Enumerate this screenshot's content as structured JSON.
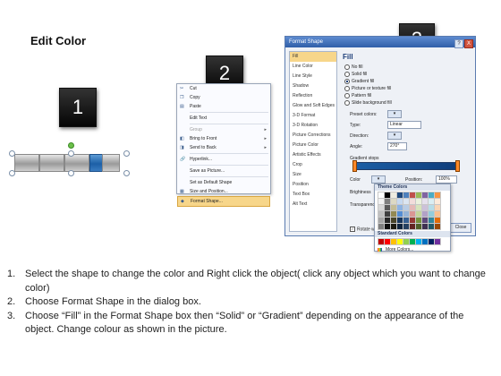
{
  "title": "Edit Color",
  "badges": [
    "1",
    "2",
    "3"
  ],
  "context_menu": {
    "items": [
      {
        "label": "Cut",
        "icon": "scissors-icon",
        "glyph": "✂",
        "enabled": true
      },
      {
        "label": "Copy",
        "icon": "copy-icon",
        "glyph": "❐",
        "enabled": true
      },
      {
        "label": "Paste",
        "icon": "paste-icon",
        "glyph": "▤",
        "enabled": true
      },
      {
        "label": "Edit Text",
        "icon": "edit-text-icon",
        "glyph": "",
        "enabled": true
      },
      {
        "label": "Group",
        "icon": "group-icon",
        "glyph": "",
        "enabled": false,
        "submenu": true
      },
      {
        "label": "Bring to Front",
        "icon": "bring-front-icon",
        "glyph": "◧",
        "enabled": true,
        "submenu": true
      },
      {
        "label": "Send to Back",
        "icon": "send-back-icon",
        "glyph": "◨",
        "enabled": true,
        "submenu": true
      },
      {
        "label": "Hyperlink...",
        "icon": "hyperlink-icon",
        "glyph": "🔗",
        "enabled": true
      },
      {
        "label": "Save as Picture...",
        "icon": "",
        "glyph": "",
        "enabled": true
      },
      {
        "label": "Set as Default Shape",
        "icon": "",
        "glyph": "",
        "enabled": true
      },
      {
        "label": "Size and Position...",
        "icon": "size-position-icon",
        "glyph": "▦",
        "enabled": true
      },
      {
        "label": "Format Shape...",
        "icon": "format-shape-icon",
        "glyph": "◆",
        "enabled": true,
        "highlighted": true
      }
    ]
  },
  "dialog": {
    "title": "Format Shape",
    "title_buttons": [
      "?",
      "X"
    ],
    "nav": [
      "Fill",
      "Line Color",
      "Line Style",
      "Shadow",
      "Reflection",
      "Glow and Soft Edges",
      "3-D Format",
      "3-D Rotation",
      "Picture Corrections",
      "Picture Color",
      "Artistic Effects",
      "Crop",
      "Size",
      "Position",
      "Text Box",
      "Alt Text"
    ],
    "nav_selected": 0,
    "panel": {
      "heading": "Fill",
      "fill_options": [
        "No fill",
        "Solid fill",
        "Gradient fill",
        "Picture or texture fill",
        "Pattern fill",
        "Slide background fill"
      ],
      "fill_selected": 2,
      "preset_label": "Preset colors:",
      "type_label": "Type:",
      "type_value": "Linear",
      "direction_label": "Direction:",
      "angle_label": "Angle:",
      "angle_value": "270°",
      "gradient_stops_label": "Gradient stops",
      "color_label": "Color",
      "position_label": "Position:",
      "position_value": "100%",
      "brightness_label": "Brightness",
      "transparency_label": "Transparency",
      "rotate_label": "Rotate with shape",
      "rotate_checked": true,
      "close_label": "Close"
    }
  },
  "color_popup": {
    "theme_heading": "Theme Colors",
    "standard_heading": "Standard Colors",
    "more_label": "More Colors...",
    "theme_top": [
      "#ffffff",
      "#000000",
      "#eeece1",
      "#1f497d",
      "#4f81bd",
      "#c0504d",
      "#9bbb59",
      "#8064a2",
      "#4bacc6",
      "#f79646"
    ],
    "theme_shades": [
      [
        "#f2f2f2",
        "#7f7f7f",
        "#ddd9c3",
        "#c6d9f0",
        "#dbe5f1",
        "#f2dcdb",
        "#ebf1dd",
        "#e5e0ec",
        "#dbeef3",
        "#fdeada"
      ],
      [
        "#d8d8d8",
        "#595959",
        "#c4bd97",
        "#8db3e2",
        "#b8cce4",
        "#e5b9b7",
        "#d7e3bc",
        "#ccc1d9",
        "#b7dde8",
        "#fbd5b5"
      ],
      [
        "#bfbfbf",
        "#3f3f3f",
        "#938953",
        "#548dd4",
        "#95b3d7",
        "#d99694",
        "#c3d69b",
        "#b2a2c7",
        "#92cddc",
        "#fac08f"
      ],
      [
        "#a5a5a5",
        "#262626",
        "#494429",
        "#17365d",
        "#366092",
        "#953734",
        "#76923c",
        "#5f497a",
        "#31859b",
        "#e36c09"
      ],
      [
        "#7f7f7f",
        "#0c0c0c",
        "#1d1b10",
        "#0f243e",
        "#244061",
        "#632423",
        "#4f6128",
        "#3f3151",
        "#205867",
        "#974806"
      ]
    ],
    "standard": [
      "#c00000",
      "#ff0000",
      "#ffc000",
      "#ffff00",
      "#92d050",
      "#00b050",
      "#00b0f0",
      "#0070c0",
      "#002060",
      "#7030a0"
    ]
  },
  "steps": [
    {
      "num": "1.",
      "text": "Select the shape to change the color and Right click the object( click any object which you want to change color)"
    },
    {
      "num": "2.",
      "text": "Choose Format Shape in the dialog box."
    },
    {
      "num": "3.",
      "text": "Choose “Fill” in the Format Shape box then “Solid” or “Gradient” depending on the appearance of the object. Change colour as shown in the picture."
    }
  ]
}
